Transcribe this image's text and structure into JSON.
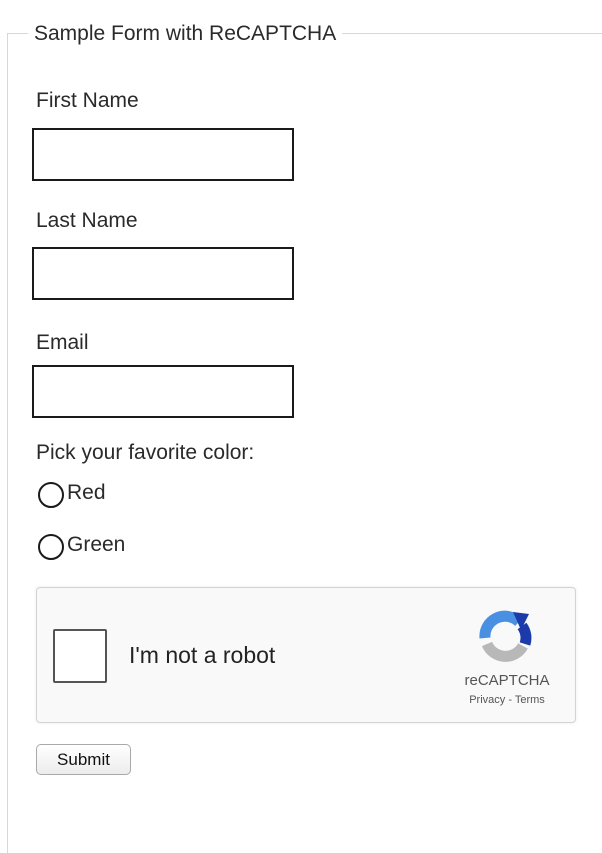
{
  "form": {
    "legend": "Sample Form with ReCAPTCHA",
    "first_name": {
      "label": "First Name",
      "value": ""
    },
    "last_name": {
      "label": "Last Name",
      "value": ""
    },
    "email": {
      "label": "Email",
      "value": ""
    },
    "color_prompt": "Pick your favorite color:",
    "color_options": [
      {
        "label": "Red",
        "selected": false
      },
      {
        "label": "Green",
        "selected": false
      }
    ],
    "submit_label": "Submit"
  },
  "captcha": {
    "checkbox_label": "I'm not a robot",
    "checked": false,
    "brand": "reCAPTCHA",
    "privacy_label": "Privacy",
    "separator": " - ",
    "terms_label": "Terms",
    "colors": {
      "logo_blue": "#1c3aa9",
      "logo_light_blue": "#4a90e2",
      "logo_gray": "#b8b8b8"
    }
  }
}
